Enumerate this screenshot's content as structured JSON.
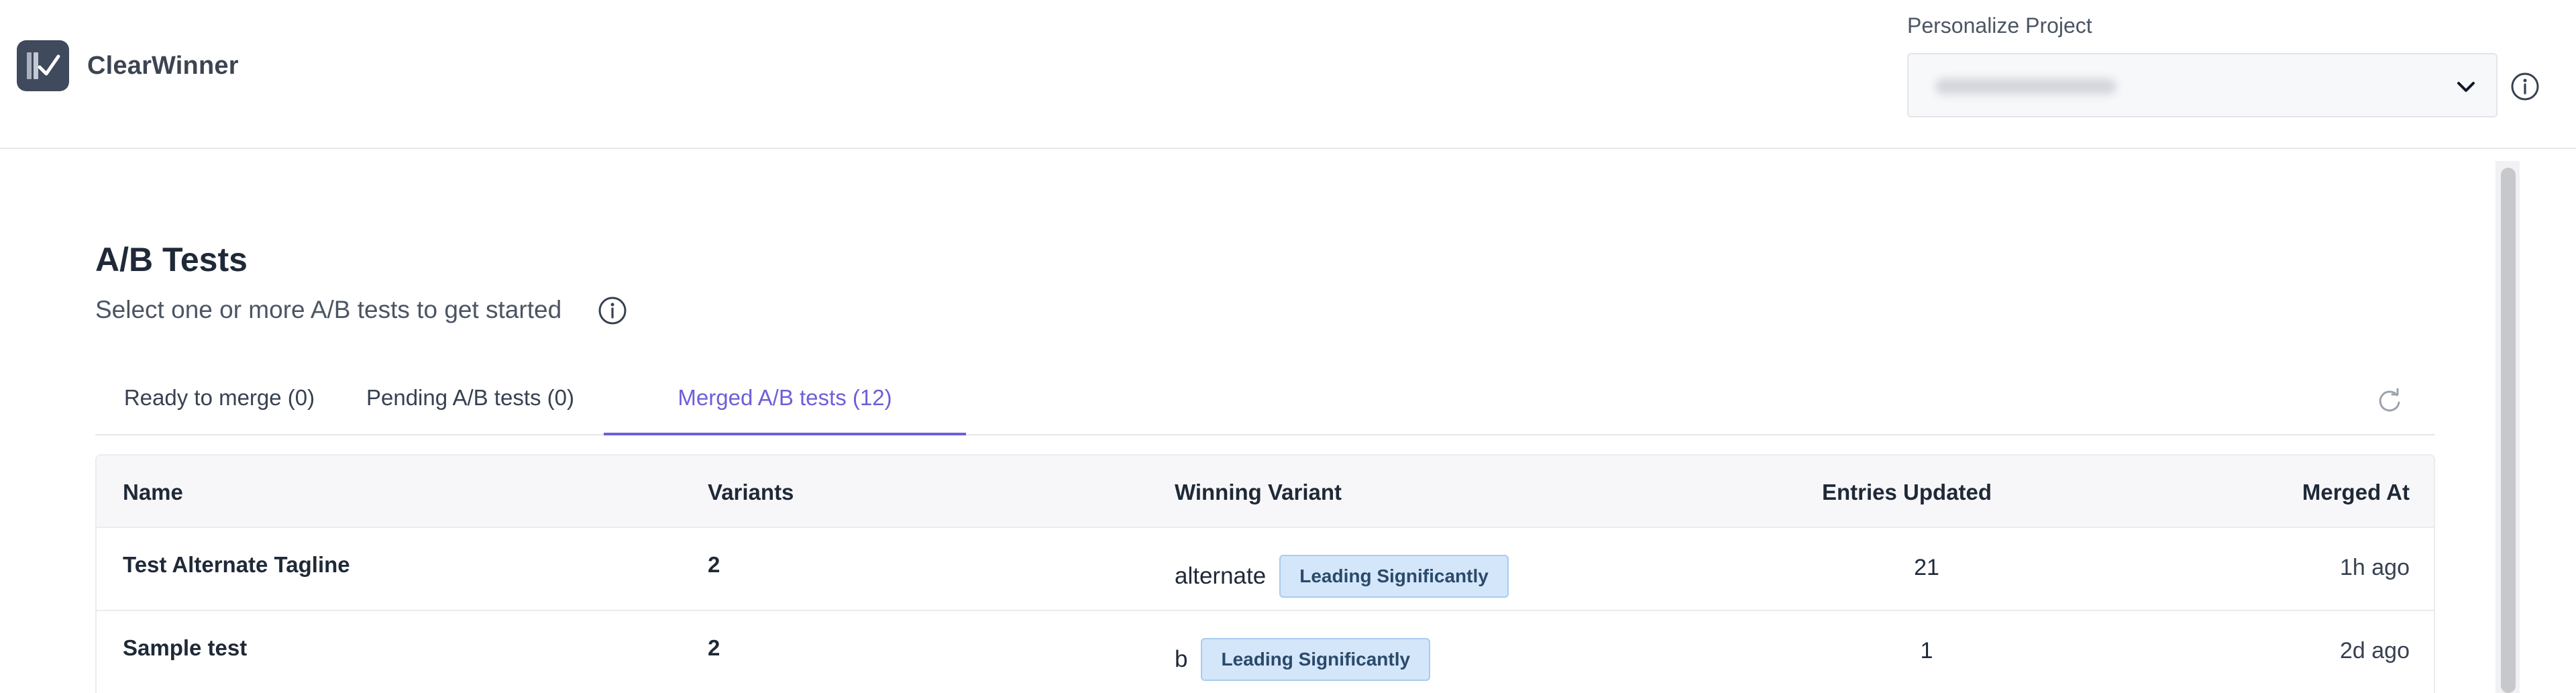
{
  "app": {
    "name": "ClearWinner"
  },
  "project_selector": {
    "label": "Personalize Project",
    "value": ""
  },
  "page": {
    "title": "A/B Tests",
    "subtitle": "Select one or more A/B tests to get started"
  },
  "tabs": [
    {
      "label": "Ready to merge (0)",
      "active": false
    },
    {
      "label": "Pending A/B tests (0)",
      "active": false
    },
    {
      "label": "Merged A/B tests (12)",
      "active": true
    }
  ],
  "table": {
    "columns": [
      "Name",
      "Variants",
      "Winning Variant",
      "Entries Updated",
      "Merged At"
    ],
    "rows": [
      {
        "name": "Test Alternate Tagline",
        "variants": "2",
        "winning_variant": "alternate",
        "badge": "Leading Significantly",
        "entries_updated": "21",
        "merged_at": "1h ago"
      },
      {
        "name": "Sample test",
        "variants": "2",
        "winning_variant": "b",
        "badge": "Leading Significantly",
        "entries_updated": "1",
        "merged_at": "2d ago"
      }
    ]
  },
  "icons": {
    "logo": "clearwinner-logo-icon",
    "dropdown": "chevron-down-icon",
    "info": "info-icon",
    "refresh": "refresh-icon"
  },
  "colors": {
    "accent": "#6d5fd8",
    "badge_bg": "#d4e6fa",
    "badge_text": "#2a4a6b",
    "logo_bg": "#3f4a5c"
  }
}
